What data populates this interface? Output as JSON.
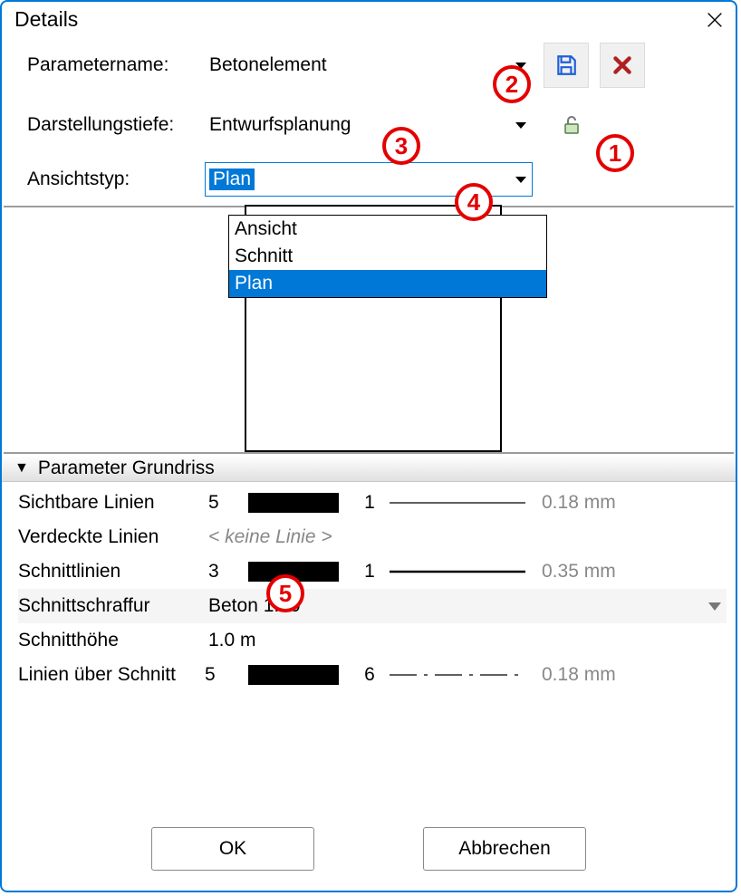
{
  "title": "Details",
  "labels": {
    "parametername": "Parametername:",
    "darstellungstiefe": "Darstellungstiefe:",
    "ansichtstyp": "Ansichtstyp:"
  },
  "parametername": {
    "value": "Betonelement"
  },
  "darstellungstiefe": {
    "value": "Entwurfsplanung"
  },
  "ansichtstyp": {
    "value": "Plan",
    "options": [
      "Ansicht",
      "Schnitt",
      "Plan"
    ],
    "selected": "Plan"
  },
  "section": {
    "title": "Parameter Grundriss"
  },
  "rows": {
    "sichtbare": {
      "label": "Sichtbare Linien",
      "a": "5",
      "b": "1",
      "mm": "0.18 mm"
    },
    "verdeckte": {
      "label": "Verdeckte Linien",
      "none": "< keine Linie >"
    },
    "schnittlinien": {
      "label": "Schnittlinien",
      "a": "3",
      "b": "1",
      "mm": "0.35 mm"
    },
    "schraffur": {
      "label": "Schnittschraffur",
      "value": "Beton 1:50"
    },
    "hoehe": {
      "label": "Schnitthöhe",
      "value": "1.0 m"
    },
    "ueber": {
      "label": "Linien über Schnitt",
      "a": "5",
      "b": "6",
      "mm": "0.18 mm"
    }
  },
  "buttons": {
    "ok": "OK",
    "cancel": "Abbrechen"
  },
  "annotations": {
    "1": "1",
    "2": "2",
    "3": "3",
    "4": "4",
    "5": "5"
  }
}
